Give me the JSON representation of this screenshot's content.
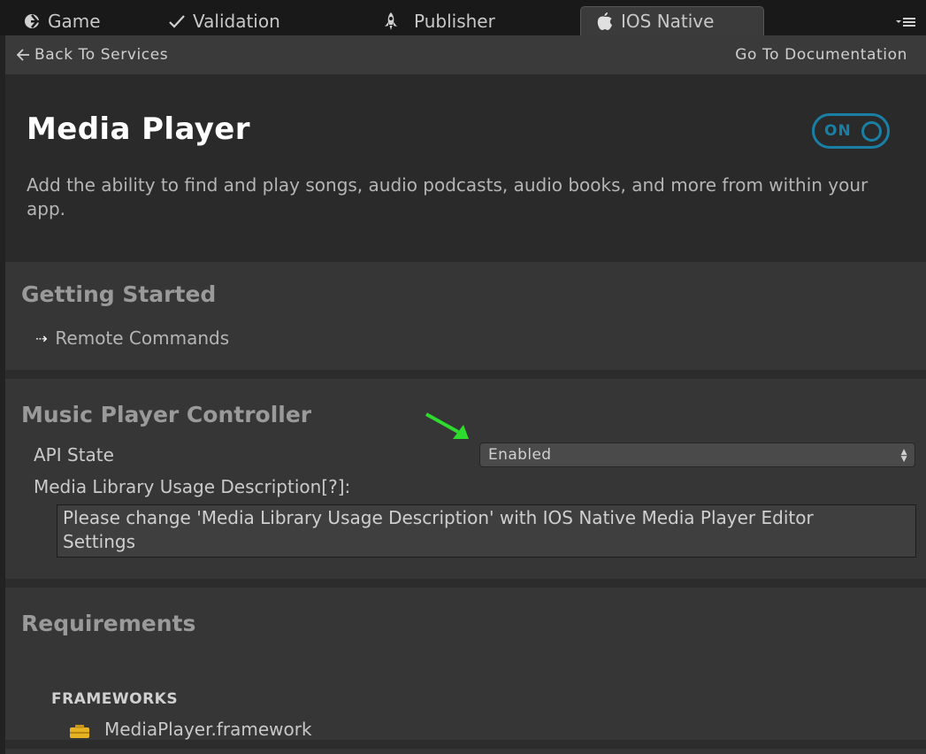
{
  "tabs": [
    {
      "label": "Game",
      "icon": "unity-icon"
    },
    {
      "label": "Validation",
      "icon": "checkmark-icon"
    },
    {
      "label": "Publisher",
      "icon": "rocket-icon"
    },
    {
      "label": "IOS Native",
      "icon": "apple-icon",
      "active": true
    }
  ],
  "nav": {
    "back_label": "Back To Services",
    "docs_label": "Go To Documentation"
  },
  "service": {
    "title": "Media Player",
    "toggle_label": "ON",
    "toggle_state": "on",
    "description": "Add the ability to find and play songs, audio podcasts, audio books, and more from within your",
    "description_line2": "app."
  },
  "getting_started": {
    "title": "Getting Started",
    "links": [
      "Remote Commands"
    ]
  },
  "music_player": {
    "title": "Music Player Controller",
    "api_state_label": "API State",
    "api_state_value": "Enabled",
    "usage_label": "Media Library Usage Description[?]:",
    "usage_text_line1": "Please change 'Media Library Usage Description' with IOS Native Media Player Editor",
    "usage_text_line2": "Settings"
  },
  "requirements": {
    "title": "Requirements",
    "frameworks_header": "FRAMEWORKS",
    "frameworks": [
      "MediaPlayer.framework"
    ]
  },
  "colors": {
    "accent": "#1a7fa5",
    "annotation_arrow": "#2edc2e",
    "framework_icon": "#e6b422"
  }
}
